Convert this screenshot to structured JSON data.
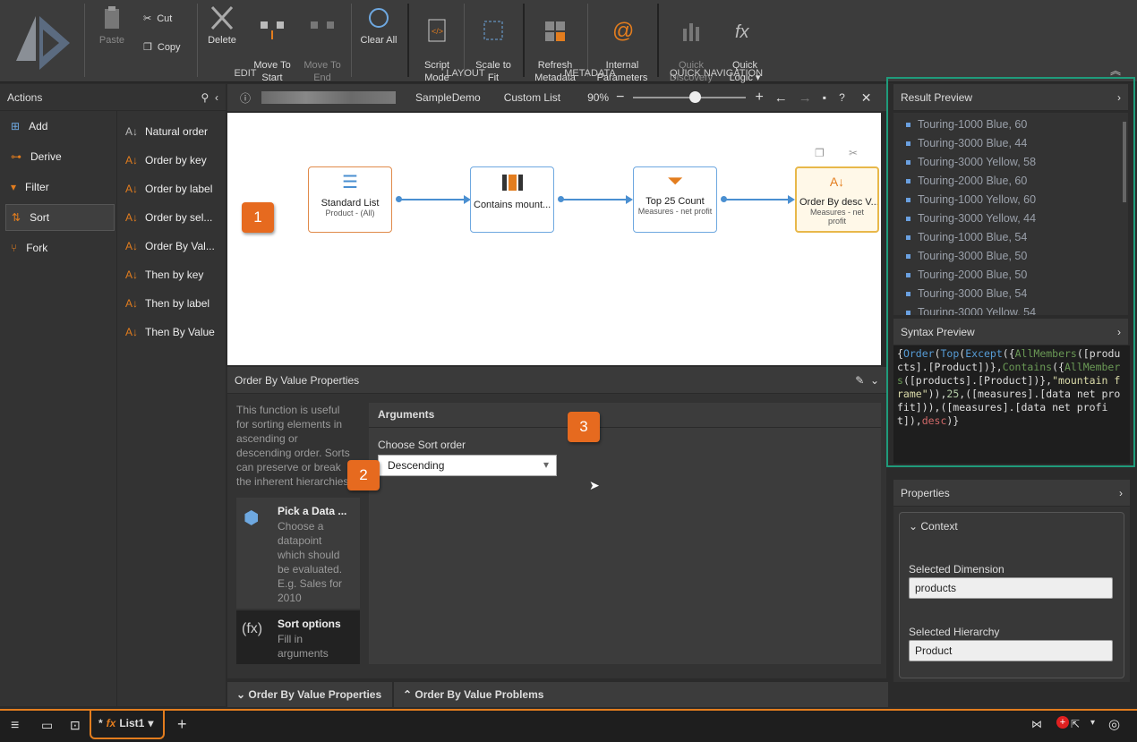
{
  "ribbon": {
    "cut": "Cut",
    "copy": "Copy",
    "paste": "Paste",
    "delete": "Delete",
    "move_to_start": "Move To\nStart",
    "move_to_end": "Move To\nEnd",
    "clear_all": "Clear All",
    "group_edit": "EDIT",
    "script_mode": "Script\nMode",
    "scale_to_fit": "Scale to\nFit",
    "group_layout": "LAYOUT",
    "refresh_metadata": "Refresh\nMetadata",
    "internal_parameters": "Internal\nParameters",
    "group_metadata": "METADATA",
    "quick_discovery": "Quick\nDiscovery",
    "quick_logic": "Quick\nLogic ▾",
    "group_quicknav": "QUICK NAVIGATION"
  },
  "actions": {
    "title": "Actions",
    "items": [
      "Add",
      "Derive",
      "Filter",
      "Sort",
      "Fork"
    ],
    "sort_items": [
      "Natural order",
      "Order by key",
      "Order by label",
      "Order by sel...",
      "Order By Val...",
      "Then by key",
      "Then by label",
      "Then By Value"
    ]
  },
  "toolbar": {
    "model": "SampleDemo",
    "list_type": "Custom List",
    "zoom": "90%",
    "zoom_level": 0.55
  },
  "flow": {
    "nodes": [
      {
        "title": "Standard List",
        "sub": "Product - (All)"
      },
      {
        "title": "Contains mount...",
        "sub": ""
      },
      {
        "title": "Top 25 Count",
        "sub": "Measures - net profit"
      },
      {
        "title": "Order By desc V...",
        "sub": "Measures - net profit"
      }
    ]
  },
  "callouts": [
    "1",
    "2",
    "3"
  ],
  "properties": {
    "title": "Order By Value Properties",
    "description": "This function is useful for sorting elements in ascending or descending order. Sorts can preserve or break the inherent hierarchies",
    "pick_title": "Pick a Data ...",
    "pick_desc": "Choose a datapoint which should be evaluated. E.g. Sales for 2010",
    "sort_title": "Sort options",
    "sort_desc": "Fill in arguments",
    "arguments_header": "Arguments",
    "sort_order_label": "Choose Sort order",
    "sort_order_value": "Descending"
  },
  "bottom_tabs": {
    "tab1": "Order By Value Properties",
    "tab2": "Order By Value Problems"
  },
  "result_preview": {
    "title": "Result Preview",
    "items": [
      "Touring-1000 Blue, 60",
      "Touring-3000 Blue, 44",
      "Touring-3000 Yellow, 58",
      "Touring-2000 Blue, 60",
      "Touring-1000 Yellow, 60",
      "Touring-3000 Yellow, 44",
      "Touring-1000 Blue, 54",
      "Touring-3000 Blue, 50",
      "Touring-2000 Blue, 50",
      "Touring-3000 Blue, 54",
      "Touring-3000 Yellow, 54"
    ]
  },
  "syntax": {
    "title": "Syntax Preview"
  },
  "props_panel": {
    "title": "Properties",
    "context": "Context",
    "dim_label": "Selected Dimension",
    "dim_value": "products",
    "hier_label": "Selected Hierarchy",
    "hier_value": "Product"
  },
  "footer": {
    "tab": "List1",
    "tab_prefix": "*"
  }
}
